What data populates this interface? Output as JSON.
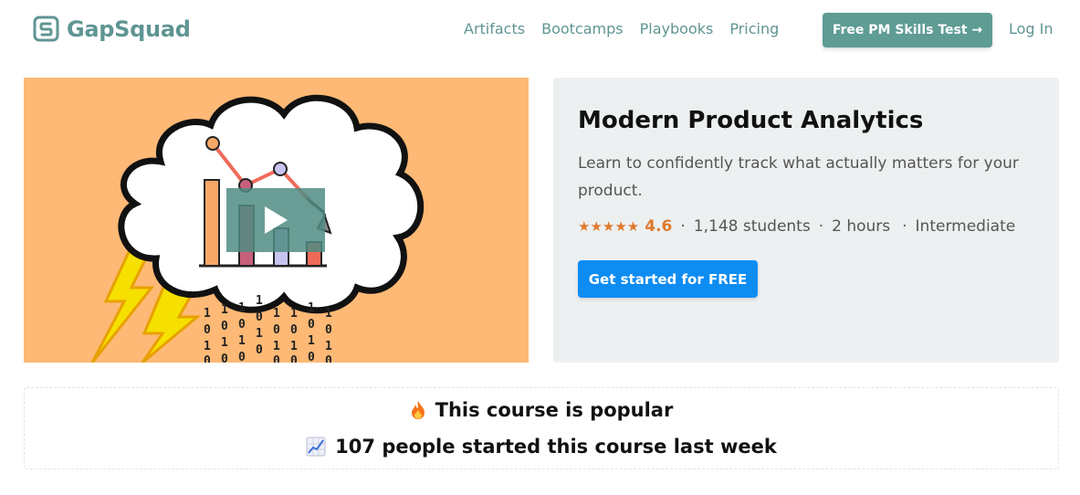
{
  "brand": {
    "name": "GapSquad",
    "color": "#5f9593"
  },
  "nav": {
    "items": [
      "Artifacts",
      "Bootcamps",
      "Playbooks",
      "Pricing"
    ],
    "cta_label": "Free PM Skills Test →",
    "login_label": "Log In"
  },
  "course": {
    "title": "Modern Product Analytics",
    "description": "Learn to confidently track what actually matters for your product.",
    "stars": "★★★★★",
    "rating": "4.6",
    "students": "1,148 students",
    "duration": "2 hours",
    "level": "Intermediate",
    "cta_label": "Get started for FREE",
    "video_icon": "play-icon"
  },
  "popularity": {
    "line1": "This course is popular",
    "line1_icon": "fire-icon",
    "line2": "107 people started this course last week",
    "line2_icon": "trending-chart-icon"
  },
  "colors": {
    "accent_teal": "#5e9c94",
    "cta_blue": "#0d8cf2",
    "rating_orange": "#e0792c",
    "video_bg": "#fdb975",
    "panel_bg": "#edf0f1"
  }
}
